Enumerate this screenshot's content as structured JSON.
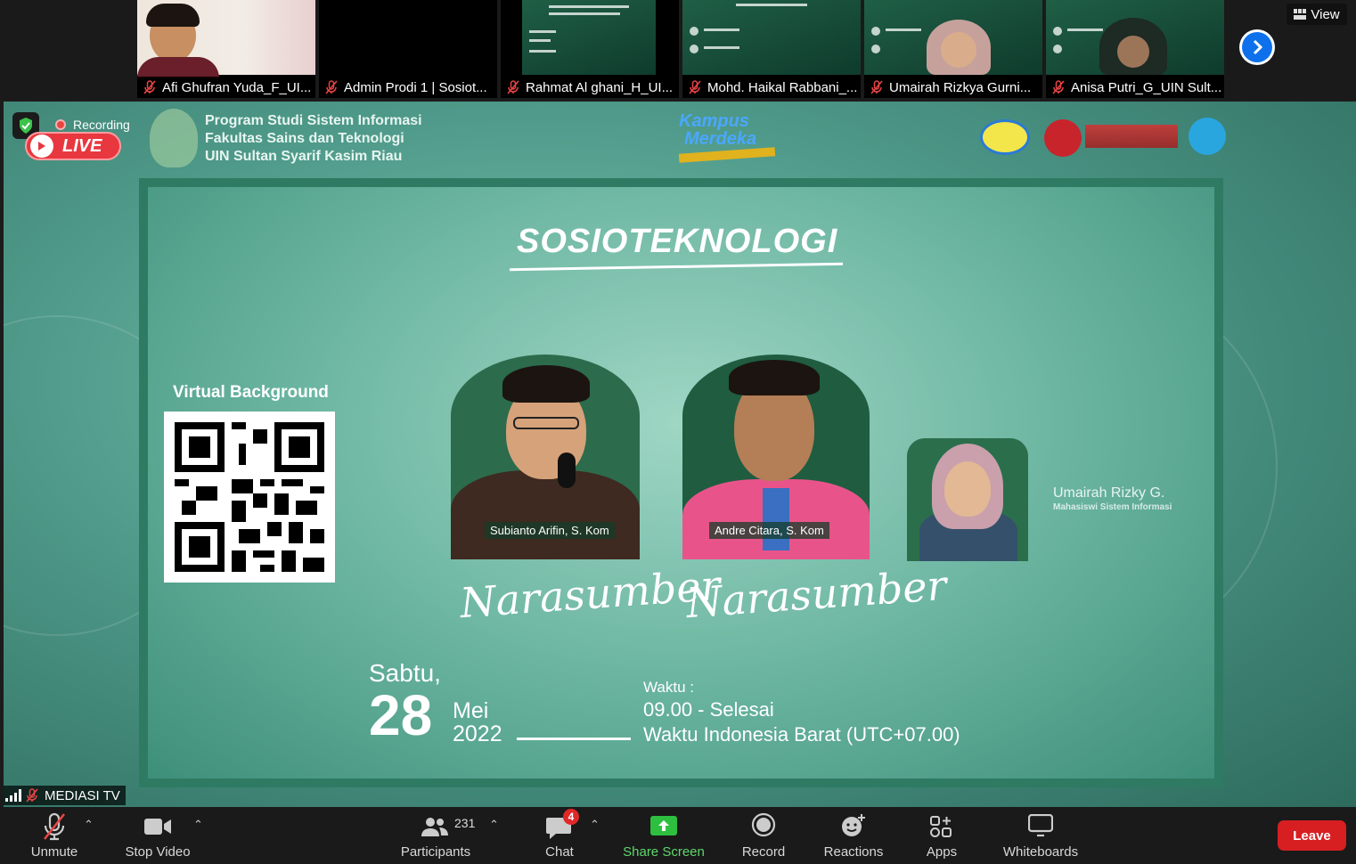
{
  "gallery": {
    "participants": [
      {
        "name": "Afi Ghufran Yuda_F_UI..."
      },
      {
        "name": "Admin Prodi 1 | Sosiot..."
      },
      {
        "name": "Rahmat Al  ghani_H_UI..."
      },
      {
        "name": "Mohd. Haikal Rabbani_..."
      },
      {
        "name": "Umairah Rizkya Gurni..."
      },
      {
        "name": "Anisa Putri_G_UIN Sult..."
      }
    ],
    "view_label": "View"
  },
  "stage": {
    "recording_label": "Recording",
    "live_label": "LIVE",
    "org_lines": [
      "Program Studi Sistem Informasi",
      "Fakultas Sains dan Teknologi",
      "UIN Sultan Syarif Kasim Riau"
    ],
    "kampus_line1": "Kampus",
    "kampus_line2": "Merdeka",
    "poster": {
      "title": "SOSIOTEKNOLOGI",
      "qr_label": "Virtual Background",
      "speaker1_name": "Subianto Arifin, S. Kom",
      "speaker2_name": "Andre Citara, S. Kom",
      "speaker_role": "Narasumber",
      "moderator_name": "Umairah Rizky G.",
      "moderator_role": "Mahasiswi Sistem Informasi",
      "day": "Sabtu,",
      "date_num": "28",
      "month": "Mei",
      "year": "2022",
      "time_label": "Waktu :",
      "time_value": "09.00 - Selesai",
      "time_zone": "Waktu Indonesia Barat (UTC+07.00)"
    },
    "active_speaker": "MEDIASI TV"
  },
  "toolbar": {
    "unmute": "Unmute",
    "stop_video": "Stop Video",
    "participants": "Participants",
    "participants_count": "231",
    "chat": "Chat",
    "chat_badge": "4",
    "share_screen": "Share Screen",
    "record": "Record",
    "reactions": "Reactions",
    "apps": "Apps",
    "whiteboards": "Whiteboards",
    "leave": "Leave"
  },
  "colors": {
    "accent_blue": "#0e71eb",
    "leave_red": "#d71f22",
    "share_green": "#5ed86b",
    "poster_green": "#2f7a62"
  }
}
